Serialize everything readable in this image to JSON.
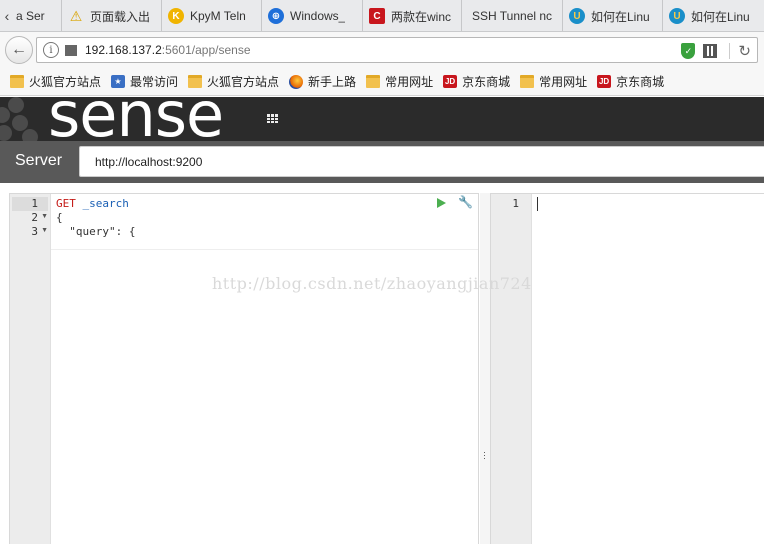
{
  "tabs": [
    {
      "label": "a Ser",
      "icon": "kibana-icon"
    },
    {
      "label": "页面载入出",
      "icon": "warning-icon"
    },
    {
      "label": "KpyM Teln",
      "icon": "kpym-icon"
    },
    {
      "label": "Windows_",
      "icon": "windows-icon"
    },
    {
      "label": "两款在winc",
      "icon": "csdn-icon"
    },
    {
      "label": "SSH Tunnel nc",
      "icon": "none"
    },
    {
      "label": "如何在Linu",
      "icon": "ubuntu-icon"
    },
    {
      "label": "如何在Linu",
      "icon": "ubuntu-icon"
    }
  ],
  "address_bar": {
    "host": "192.168.137.2",
    "rest": ":5601/app/sense"
  },
  "bookmarks": [
    {
      "label": "火狐官方站点",
      "icon": "folder-icon"
    },
    {
      "label": "最常访问",
      "icon": "star-icon"
    },
    {
      "label": "火狐官方站点",
      "icon": "folder-icon"
    },
    {
      "label": "新手上路",
      "icon": "firefox-icon"
    },
    {
      "label": "常用网址",
      "icon": "folder-icon"
    },
    {
      "label": "京东商城",
      "icon": "jd-icon"
    },
    {
      "label": "常用网址",
      "icon": "folder-icon"
    },
    {
      "label": "京东商城",
      "icon": "jd-icon"
    }
  ],
  "app": {
    "logo": "sense"
  },
  "server": {
    "label": "Server",
    "value": "http://localhost:9200"
  },
  "request_editor": {
    "lines": [
      {
        "num": "1",
        "method": "GET",
        "path": "_search"
      },
      {
        "num": "2",
        "text": "{"
      },
      {
        "num": "3",
        "text": "  \"query\": {"
      }
    ]
  },
  "response_editor": {
    "lines": [
      {
        "num": "1"
      }
    ]
  },
  "watermark": "http://blog.csdn.net/zhaoyangjian724",
  "colors": {
    "header_bg": "#2b2b2b",
    "server_bar_bg": "#595959",
    "method_color": "#c41a16",
    "path_color": "#1a5fb4",
    "run_button": "#4caf50"
  }
}
